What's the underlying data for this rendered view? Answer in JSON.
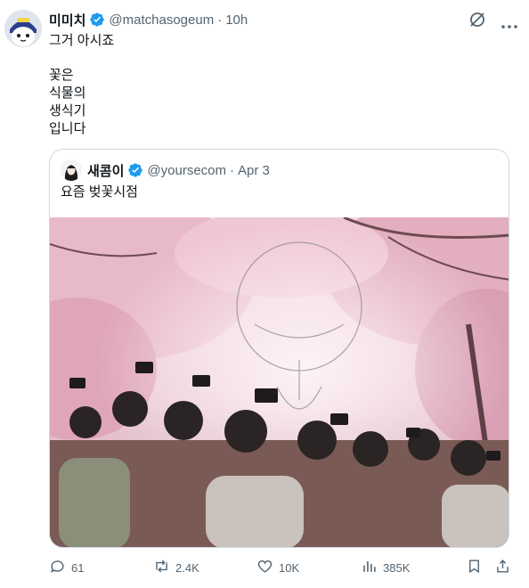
{
  "tweet": {
    "display_name": "미미치",
    "handle": "@matchasogeum",
    "separator": "·",
    "time": "10h",
    "lines": [
      "그거 아시죠",
      "꽃은",
      "식물의",
      "생식기",
      "입니다"
    ],
    "verified_color": "#1d9bf0"
  },
  "quote": {
    "display_name": "새콤이",
    "handle": "@yoursecom",
    "separator": "·",
    "date": "Apr 3",
    "text": "요즘 벚꽃시점"
  },
  "metrics": {
    "replies": "61",
    "reposts": "2.4K",
    "likes": "10K",
    "views": "385K"
  },
  "icons": [
    "grok-icon",
    "more-icon",
    "reply-icon",
    "repost-icon",
    "like-icon",
    "views-icon",
    "bookmark-icon",
    "share-icon"
  ]
}
